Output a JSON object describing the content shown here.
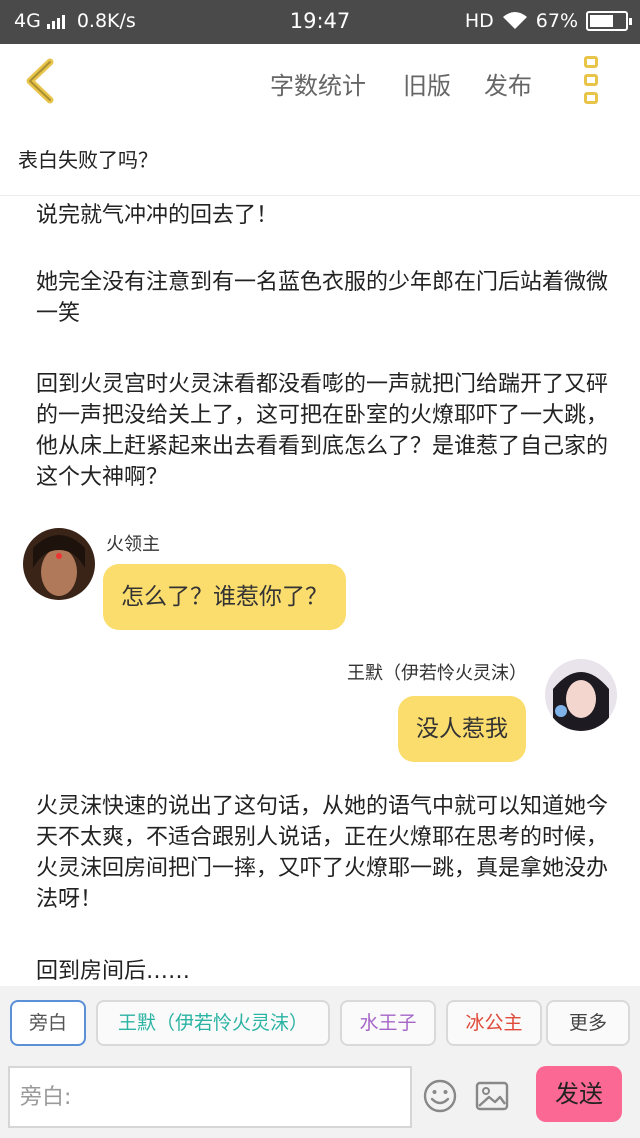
{
  "status_bar": {
    "network": "4G",
    "speed": "0.8K/s",
    "time": "19:47",
    "hd": "HD",
    "battery": "67%",
    "battery_level": 0.67
  },
  "header": {
    "word_count": "字数统计",
    "old_version": "旧版",
    "publish": "发布"
  },
  "subtitle": "表白失败了吗？",
  "paragraphs": [
    "说完就气冲冲的回去了！",
    "她完全没有注意到有一名蓝色衣服的少年郎在门后站着微微一笑",
    "回到火灵宫时火灵沫看都没看嘭的一声就把门给踹开了又砰的一声把没给关上了，这可把在卧室的火燎耶吓了一大跳，他从床上赶紧起来出去看看到底怎么了？是谁惹了自己家的这个大神啊？",
    "火灵沫快速的说出了这句话，从她的语气中就可以知道她今天不太爽，不适合跟别人说话，正在火燎耶在思考的时候，火灵沫回房间把门一摔，又吓了火燎耶一跳，真是拿她没办法呀！",
    "回到房间后……"
  ],
  "messages": [
    {
      "speaker": "火领主",
      "text": "怎么了？谁惹你了？",
      "side": "left"
    },
    {
      "speaker": "王默（伊若怜火灵沫）",
      "text": "没人惹我",
      "side": "right"
    }
  ],
  "role_chips": [
    {
      "label": "旁白",
      "color": "#555555",
      "selected": true
    },
    {
      "label": "王默（伊若怜火灵沫）",
      "color": "#2bb3a3",
      "selected": false
    },
    {
      "label": "水王子",
      "color": "#a565c8",
      "selected": false
    },
    {
      "label": "冰公主",
      "color": "#e04a3a",
      "selected": false
    },
    {
      "label": "更多",
      "color": "#444444",
      "selected": false
    }
  ],
  "composer": {
    "placeholder": "旁白:",
    "send_label": "发送"
  },
  "colors": {
    "bubble": "#fbdd6e",
    "accent_yellow": "#e8c44a",
    "send_button": "#fa6893",
    "selected_chip_border": "#5b8fd6"
  },
  "icons": [
    "back-arrow-icon",
    "more-menu-icon",
    "emoji-icon",
    "image-icon",
    "wifi-icon",
    "signal-icon",
    "battery-icon"
  ]
}
